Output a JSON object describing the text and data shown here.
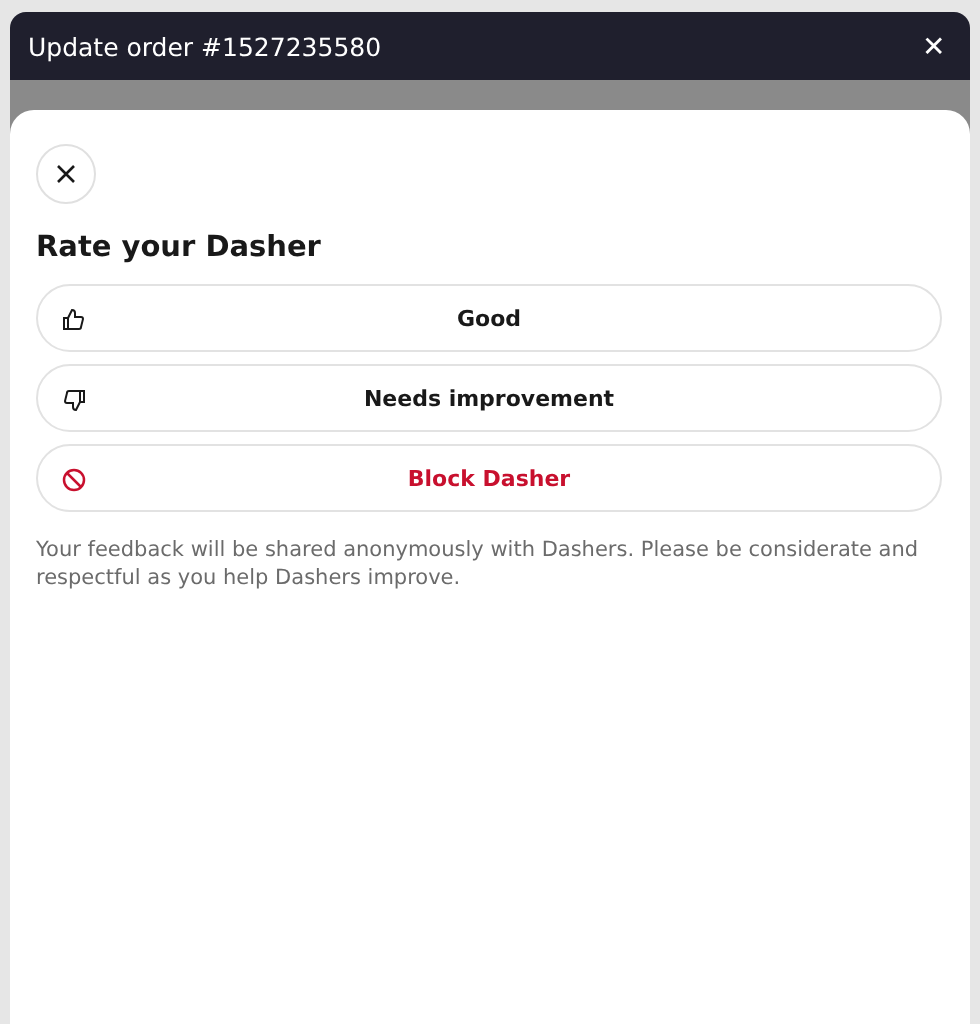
{
  "header": {
    "title": "Update order #1527235580",
    "close": "✕"
  },
  "sheet": {
    "title": "Rate your Dasher",
    "options": [
      {
        "kind": "thumbs-up",
        "label": "Good"
      },
      {
        "kind": "thumbs-down",
        "label": "Needs improvement"
      },
      {
        "kind": "block",
        "label": "Block Dasher"
      }
    ],
    "note": "Your feedback will be shared anonymously with Dashers. Please be considerate and respectful as you help Dashers improve."
  }
}
